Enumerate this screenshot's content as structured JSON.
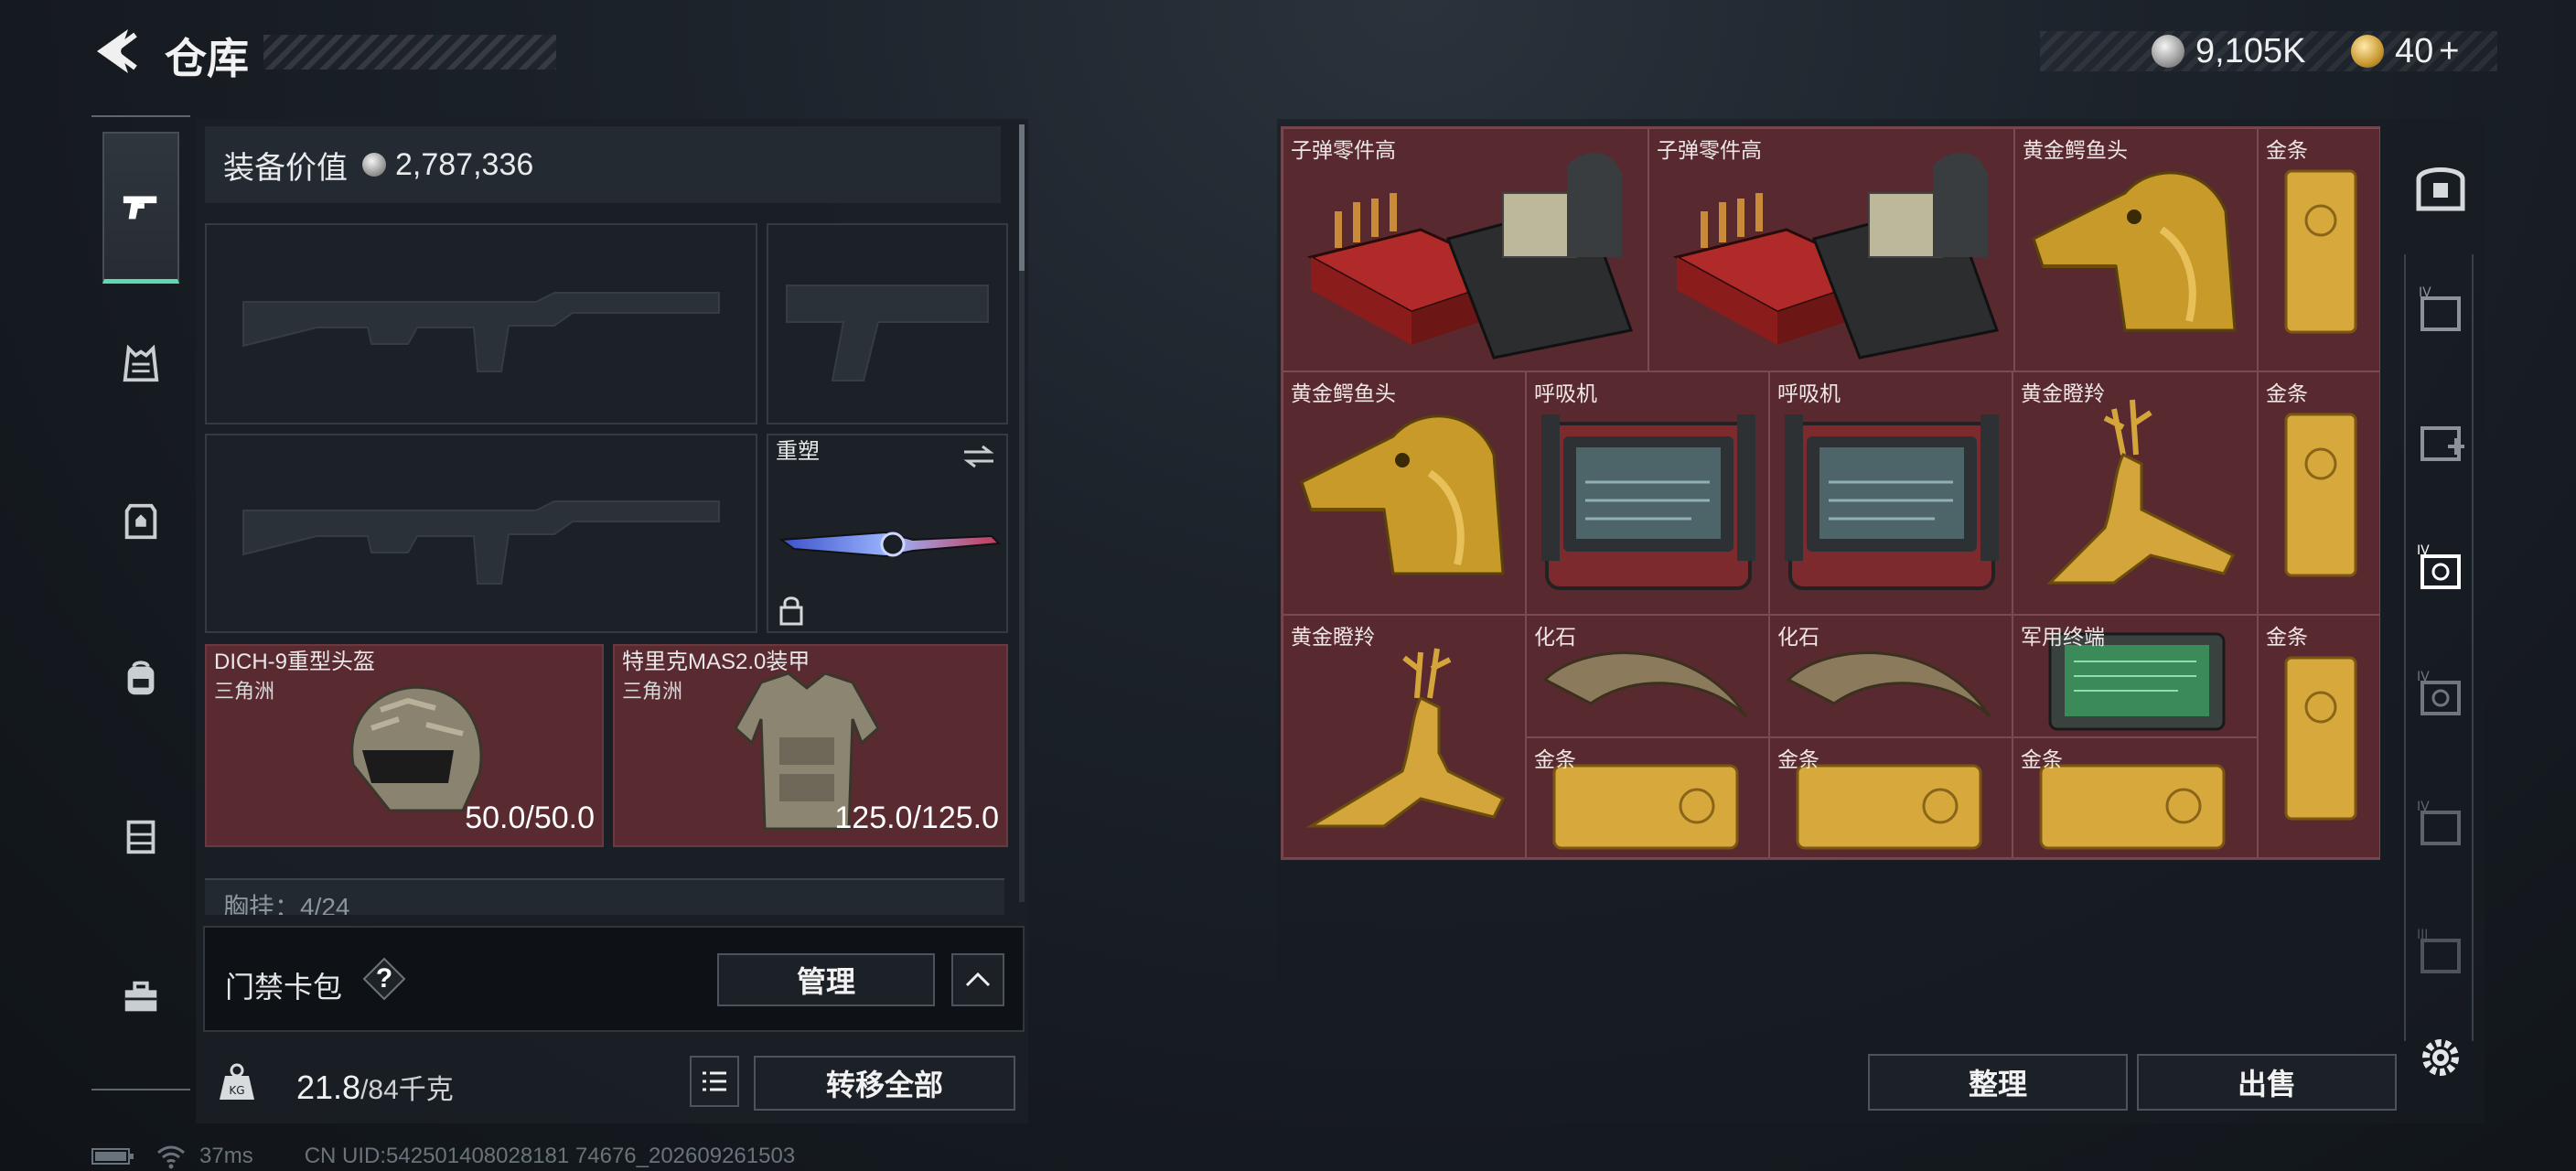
{
  "header": {
    "title": "仓库",
    "silver_amount": "9,105K",
    "gold_amount": "40",
    "gold_add": "+"
  },
  "nav": {
    "items": [
      "weapons",
      "outfit",
      "armor",
      "backpack",
      "chest-rig",
      "toolbox"
    ],
    "active": 0
  },
  "equipment": {
    "value_label": "装备价值",
    "value_amount": "2,787,336",
    "melee_label": "重塑",
    "helmet": {
      "name": "DICH-9重型头盔",
      "faction": "三角洲",
      "durability": "50.0/50.0"
    },
    "armor": {
      "name": "特里克MAS2.0装甲",
      "faction": "三角洲",
      "durability": "125.0/125.0"
    },
    "chest_label": "胸挂：4/24"
  },
  "keycard": {
    "label": "门禁卡包",
    "help": "?",
    "manage_label": "管理"
  },
  "weight": {
    "current": "21.8",
    "max": "/84千克",
    "transfer_all_label": "转移全部"
  },
  "status": {
    "ping": "37ms",
    "uid": "CN UID:542501408028181 74676_202609261503"
  },
  "stash": {
    "items": [
      {
        "name": "子弹零件高"
      },
      {
        "name": "子弹零件高"
      },
      {
        "name": "黄金鳄鱼头"
      },
      {
        "name": "金条"
      },
      {
        "name": "黄金鳄鱼头"
      },
      {
        "name": "呼吸机"
      },
      {
        "name": "呼吸机"
      },
      {
        "name": "黄金瞪羚"
      },
      {
        "name": "金条"
      },
      {
        "name": "黄金瞪羚"
      },
      {
        "name": "化石"
      },
      {
        "name": "化石"
      },
      {
        "name": "军用终端"
      },
      {
        "name": "金条"
      },
      {
        "name": "金条"
      },
      {
        "name": "金条"
      },
      {
        "name": "金条"
      }
    ],
    "sort_label": "整理",
    "sell_label": "出售"
  },
  "colors": {
    "accent_green": "#5ddbb0",
    "cell_red": "#5a2a30",
    "gold": "#d4a53a"
  }
}
